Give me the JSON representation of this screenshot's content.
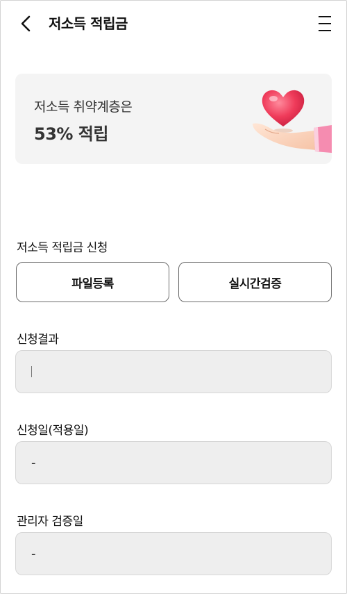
{
  "header": {
    "title": "저소득 적립금",
    "back_icon": "chevron-left-icon",
    "menu_icon": "hamburger-menu-icon"
  },
  "banner": {
    "subtitle": "저소득 취약계층은",
    "headline": "53% 적립",
    "illustration": "heart-in-hand-icon",
    "background": "#f4f4f4"
  },
  "apply": {
    "label": "저소득 적립금 신청",
    "file_button": "파일등록",
    "verify_button": "실시간검증"
  },
  "result": {
    "label": "신청결과",
    "value": ""
  },
  "apply_date": {
    "label": "신청일(적용일)",
    "value": "-"
  },
  "verify_date": {
    "label": "관리자 검증일",
    "value": "-"
  },
  "colors": {
    "heart": "#ef3b5a",
    "sleeve": "#f58cb0",
    "field_bg": "#eeeeee",
    "button_border": "#6a6a6a"
  }
}
